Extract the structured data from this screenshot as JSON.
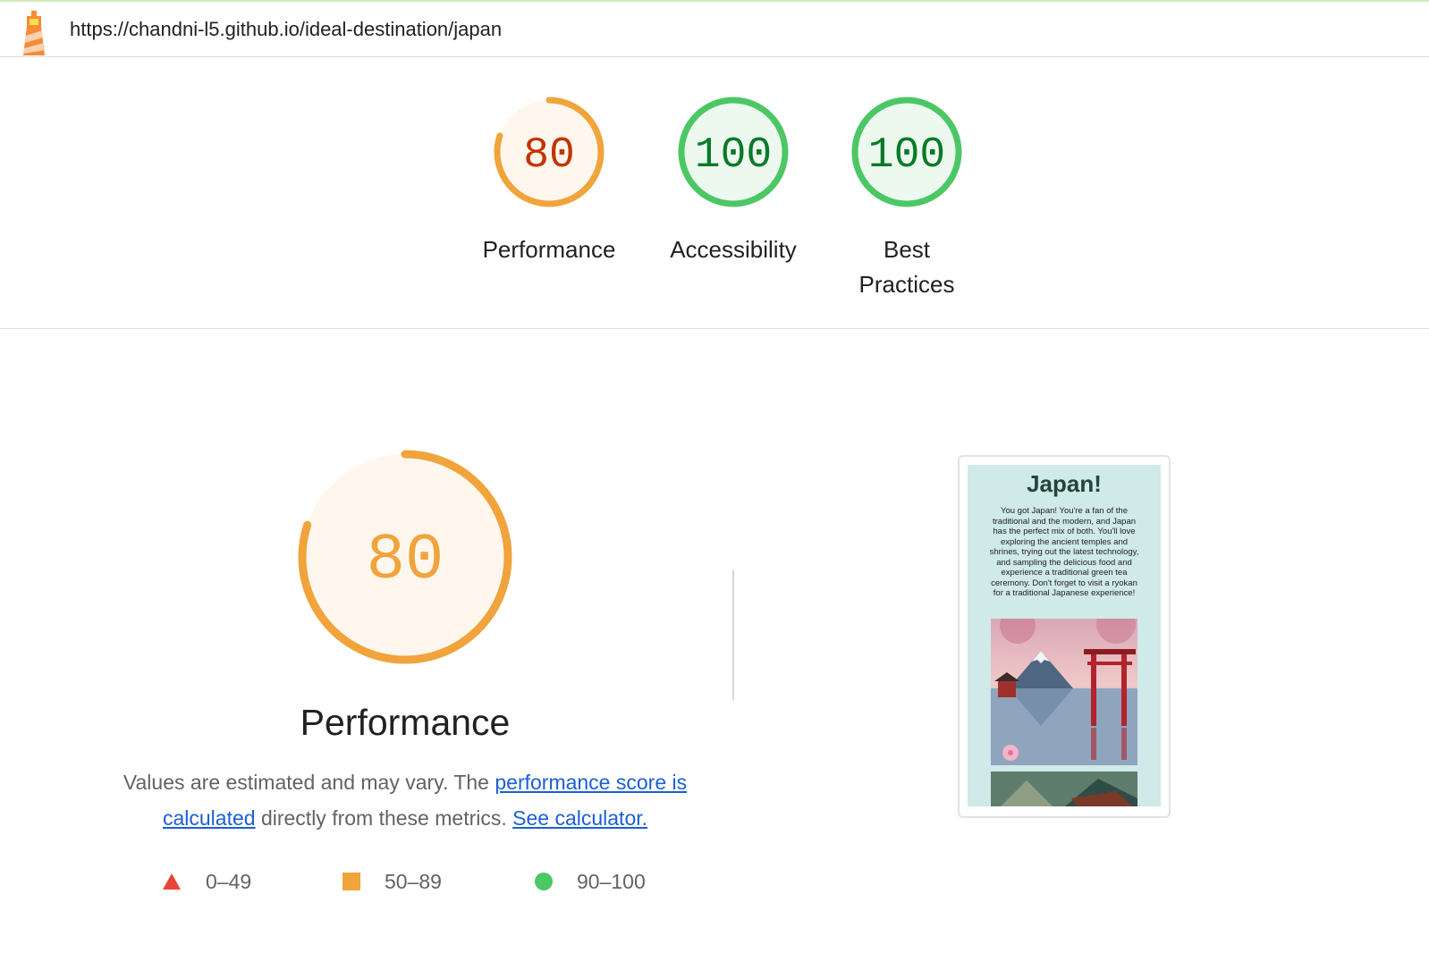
{
  "url_bar": {
    "url": "https://chandni-l5.github.io/ideal-destination/japan",
    "icon": "lighthouse-icon"
  },
  "categories": [
    {
      "score": "80",
      "label": "Performance",
      "progress": 0.8,
      "color": "#f1a33c",
      "text_color": "#c33300",
      "bg": "#fff7ed"
    },
    {
      "score": "100",
      "label": "Accessibility",
      "progress": 1.0,
      "color": "#4cc764",
      "text_color": "#0a7a2a",
      "bg": "#edf9ef"
    },
    {
      "score": "100",
      "label": "Best Practices",
      "progress": 1.0,
      "color": "#4cc764",
      "text_color": "#0a7a2a",
      "bg": "#edf9ef"
    }
  ],
  "performance": {
    "score": "80",
    "progress": 0.8,
    "title": "Performance",
    "desc_text_1": "Values are estimated and may vary. The ",
    "desc_link_1": "performance score is calculated",
    "desc_text_2": " directly from these metrics. ",
    "desc_link_2": "See calculator."
  },
  "legend": [
    {
      "range": "0–49",
      "shape": "triangle",
      "color": "#e8443a"
    },
    {
      "range": "50–89",
      "shape": "square",
      "color": "#f1a33c"
    },
    {
      "range": "90–100",
      "shape": "circle",
      "color": "#4cc764"
    }
  ],
  "screenshot": {
    "title": "Japan!",
    "text": "You got Japan! You're a fan of the traditional and the modern, and Japan has the perfect mix of both. You'll love exploring the ancient temples and shrines, trying out the latest technology, and sampling the delicious food and experience a traditional green tea ceremony. Don't forget to visit a ryokan for a traditional Japanese experience!",
    "image_subject": "Mount Fuji with torii gate, pagoda, cherry blossoms and lake reflection"
  }
}
